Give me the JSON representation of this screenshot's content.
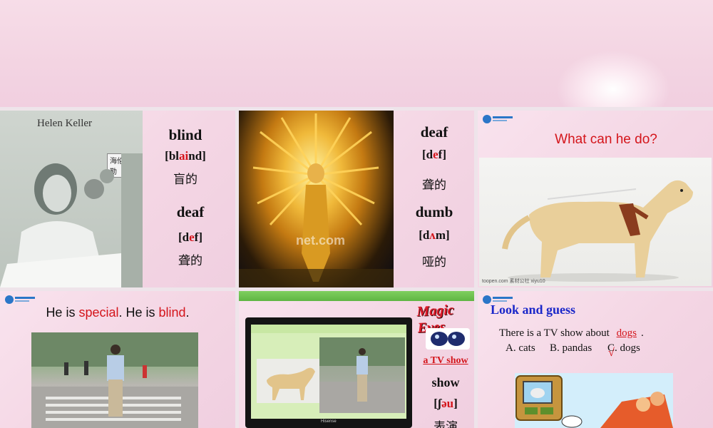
{
  "slide1": {
    "photo_caption": "Helen Keller",
    "photo_tag": "海伦.凯勒",
    "word1": "blind",
    "word1_phon_pre": "[bl",
    "word1_phon_hl": "ai",
    "word1_phon_post": "nd]",
    "word1_cn": "盲的",
    "word2": "deaf",
    "word2_phon_pre": "[d",
    "word2_phon_hl": "e",
    "word2_phon_post": "f]",
    "word2_cn": "聋的"
  },
  "slide2": {
    "watermark": "net.com",
    "word1": "deaf",
    "word1_phon_pre": "[d",
    "word1_phon_hl": "e",
    "word1_phon_post": "f]",
    "word1_cn": "聋的",
    "word2": "dumb",
    "word2_phon_pre": "[d",
    "word2_phon_hl": "ʌ",
    "word2_phon_post": "m]",
    "word2_cn": "哑的"
  },
  "slide3": {
    "question": "What can he do?",
    "photo_watermark": "toopen.com 素材公社 xiyu10"
  },
  "slide4": {
    "s1": "He is ",
    "s1_hl": "special",
    "s1_end": ". He is ",
    "s2_hl": "blind",
    "s2_end": "."
  },
  "slide5": {
    "title": "Magic Eyes",
    "link": "a TV show",
    "word": "show",
    "phon_pre": "[ʃ",
    "phon_hl": "əu",
    "phon_post": "]",
    "cn": "表演",
    "tv_brand": "Hisense"
  },
  "slide6": {
    "heading": "Look and guess",
    "sentence_pre": "There is a TV show about ",
    "answer": "dogs",
    "sentence_post": ".",
    "option_a": "A. cats",
    "option_b": "B. pandas",
    "option_c": "C. dogs",
    "check_mark": "√"
  },
  "colors": {
    "accent_red": "#d4151b",
    "heading_blue": "#1a27c9",
    "slide_pink": "#f4d6e4"
  }
}
